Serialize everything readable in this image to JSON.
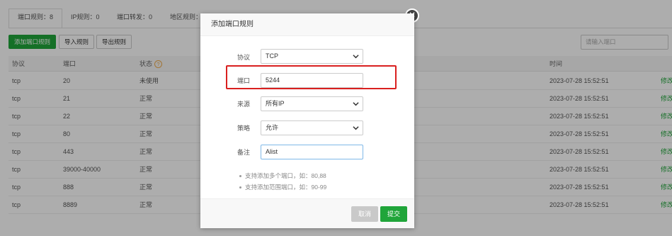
{
  "tabs": [
    {
      "label": "端口规则：8"
    },
    {
      "label": "IP规则：0"
    },
    {
      "label": "端口转发：0"
    },
    {
      "label": "地区规则："
    }
  ],
  "toolbar": {
    "add_rule": "添加端口规则",
    "import_rule": "导入规则",
    "export_rule": "导出规则"
  },
  "search": {
    "placeholder": "请输入端口"
  },
  "table": {
    "headers": {
      "protocol": "协议",
      "port": "端口",
      "status": "状态",
      "time": "时间",
      "help": "?"
    },
    "rows": [
      {
        "protocol": "tcp",
        "port": "20",
        "status": "未使用",
        "time": "2023-07-28 15:52:51",
        "action": "修改"
      },
      {
        "protocol": "tcp",
        "port": "21",
        "status": "正常",
        "time": "2023-07-28 15:52:51",
        "action": "修改"
      },
      {
        "protocol": "tcp",
        "port": "22",
        "status": "正常",
        "time": "2023-07-28 15:52:51",
        "action": "修改"
      },
      {
        "protocol": "tcp",
        "port": "80",
        "status": "正常",
        "time": "2023-07-28 15:52:51",
        "action": "修改"
      },
      {
        "protocol": "tcp",
        "port": "443",
        "status": "正常",
        "time": "2023-07-28 15:52:51",
        "action": "修改"
      },
      {
        "protocol": "tcp",
        "port": "39000-40000",
        "status": "正常",
        "time": "2023-07-28 15:52:51",
        "action": "修改"
      },
      {
        "protocol": "tcp",
        "port": "888",
        "status": "正常",
        "time": "2023-07-28 15:52:51",
        "action": "修改"
      },
      {
        "protocol": "tcp",
        "port": "8889",
        "status": "正常",
        "time": "2023-07-28 15:52:51",
        "action": "修改"
      }
    ]
  },
  "modal": {
    "title": "添加端口规则",
    "close_glyph": "✕",
    "protocol_label": "协议",
    "protocol_value": "TCP",
    "port_label": "端口",
    "port_value": "5244",
    "source_label": "来源",
    "source_value": "所有IP",
    "strategy_label": "策略",
    "strategy_value": "允许",
    "remark_label": "备注",
    "remark_value": "Alist",
    "tips": [
      "支持添加多个端口，如：80,88",
      "支持添加范围端口，如：90-99"
    ],
    "cancel_label": "取消",
    "submit_label": "提交"
  },
  "colors": {
    "accent": "#20a53a",
    "highlight": "#d9201f",
    "overlay": "rgba(0,0,0,0.32)"
  },
  "icons": {
    "close": "close-icon",
    "help": "help-icon",
    "dropdown": "chevron-down-icon"
  }
}
